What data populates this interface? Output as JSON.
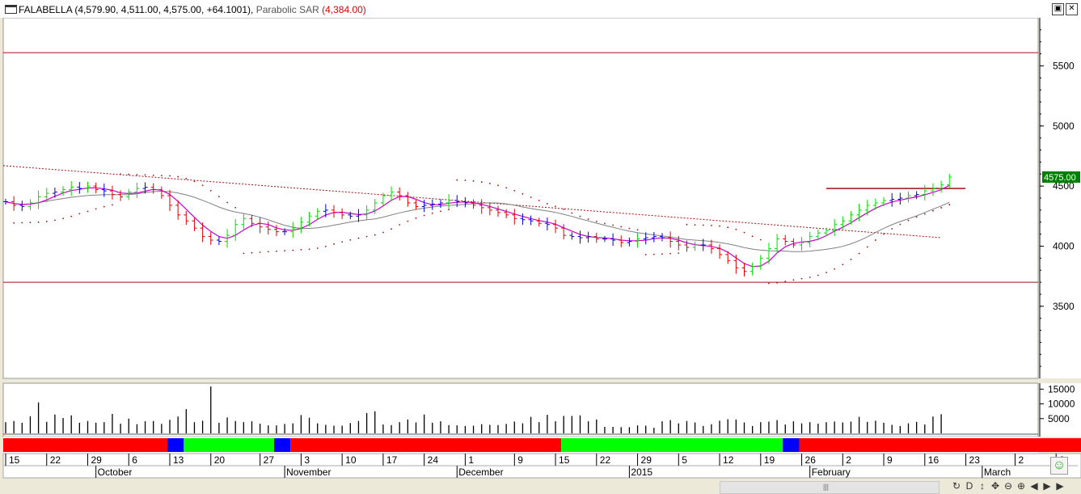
{
  "window": {
    "symbol": "FALABELLA",
    "ohlc_text": "(4,579.90, 4,511.00, 4,575.00, +64.1001),",
    "indicator_name": "Parabolic SAR",
    "indicator_value": "(4,384.00)",
    "restore_icon": "restore-icon",
    "close_icon": "close-icon",
    "restore_glyph": "▣",
    "close_glyph": "✕"
  },
  "colors": {
    "up": "#00dd00",
    "down": "#e00000",
    "neutral": "#0000cc",
    "short_ma": "#cc00cc",
    "long_ma": "#808080",
    "trendline": "#a01010",
    "sar": "#a01010",
    "volume": "#000000",
    "price_tag_bg": "#008000",
    "price_tag_fg": "#ffffff"
  },
  "chart_data": [
    {
      "type": "line",
      "chart": "price",
      "description_items": [
        "OHLC bars (green up, red down, blue neutral)",
        "Parabolic SAR dots",
        "short moving average",
        "long moving average"
      ],
      "ylim": [
        2900,
        5900
      ],
      "y_ticks": [
        3500,
        4000,
        4500,
        5000,
        5500
      ],
      "last_price_tag": "4575.00",
      "horizontal_levels": [
        5610,
        3700
      ],
      "resistance_segment": {
        "from_bar": 100,
        "to_bar": 114,
        "value": 4480
      },
      "trendline": {
        "from_bar": 0,
        "from_value": 4670,
        "to_bar": 114,
        "to_value": 4070
      },
      "bars": [
        [
          4,
          3
        ],
        [
          4,
          2
        ],
        [
          4,
          2
        ],
        [
          4,
          2
        ],
        [
          4,
          2
        ],
        [
          4,
          1
        ],
        [
          4,
          1
        ],
        [
          4,
          1
        ],
        [
          4,
          1
        ],
        [
          4,
          1
        ],
        [
          4,
          1
        ],
        [
          4,
          1
        ],
        [
          4,
          0
        ],
        [
          4,
          0
        ],
        [
          4,
          0
        ],
        [
          4,
          0
        ],
        [
          5,
          0
        ],
        [
          5,
          0
        ],
        [
          5,
          0
        ],
        [
          5,
          0
        ],
        [
          5,
          0
        ],
        [
          5,
          0
        ],
        [
          5,
          0
        ],
        [
          5,
          0
        ],
        [
          5,
          0
        ],
        [
          5,
          0
        ],
        [
          5,
          0
        ],
        [
          5,
          0
        ],
        [
          5,
          0
        ],
        [
          5,
          0
        ],
        [
          5,
          0
        ],
        [
          6,
          0
        ],
        [
          6,
          0
        ],
        [
          6,
          0
        ],
        [
          6,
          0
        ],
        [
          6,
          0
        ],
        [
          6,
          0
        ],
        [
          6,
          0
        ],
        [
          6,
          0
        ],
        [
          6,
          0
        ],
        [
          6,
          0
        ],
        [
          6,
          0
        ],
        [
          6,
          0
        ],
        [
          6,
          0
        ],
        [
          6,
          0
        ],
        [
          6,
          0
        ],
        [
          7,
          0
        ],
        [
          7,
          0
        ],
        [
          7,
          0
        ],
        [
          7,
          0
        ],
        [
          7,
          0
        ],
        [
          7,
          0
        ],
        [
          7,
          0
        ],
        [
          7,
          0
        ],
        [
          7,
          0
        ],
        [
          7,
          0
        ],
        [
          7,
          0
        ],
        [
          7,
          0
        ],
        [
          7,
          0
        ],
        [
          7,
          0
        ],
        [
          7,
          0
        ],
        [
          8,
          0
        ],
        [
          8,
          0
        ],
        [
          8,
          0
        ],
        [
          8,
          0
        ],
        [
          8,
          0
        ],
        [
          8,
          0
        ],
        [
          8,
          0
        ],
        [
          8,
          0
        ],
        [
          8,
          0
        ],
        [
          8,
          0
        ],
        [
          8,
          0
        ],
        [
          8,
          0
        ],
        [
          8,
          0
        ],
        [
          8,
          0
        ],
        [
          8,
          0
        ],
        [
          9,
          0
        ],
        [
          9,
          0
        ],
        [
          9,
          0
        ],
        [
          9,
          0
        ],
        [
          9,
          0
        ],
        [
          9,
          0
        ],
        [
          9,
          0
        ],
        [
          9,
          0
        ],
        [
          9,
          0
        ],
        [
          9,
          0
        ],
        [
          9,
          0
        ],
        [
          9,
          0
        ],
        [
          9,
          0
        ],
        [
          9,
          0
        ],
        [
          9,
          0
        ],
        [
          10,
          0
        ],
        [
          10,
          0
        ],
        [
          10,
          0
        ],
        [
          10,
          0
        ],
        [
          10,
          0
        ],
        [
          10,
          0
        ],
        [
          10,
          0
        ],
        [
          10,
          0
        ],
        [
          10,
          0
        ],
        [
          10,
          0
        ],
        [
          10,
          0
        ],
        [
          10,
          0
        ],
        [
          10,
          0
        ],
        [
          10,
          0
        ],
        [
          10,
          0
        ],
        [
          10,
          0
        ],
        [
          10,
          0
        ],
        [
          10,
          0
        ],
        [
          10,
          0
        ],
        [
          10,
          0
        ],
        [
          10,
          0
        ]
      ],
      "closes": [
        4370,
        4340,
        4330,
        4360,
        4410,
        4440,
        4450,
        4470,
        4490,
        4480,
        4500,
        4470,
        4460,
        4430,
        4410,
        4450,
        4480,
        4490,
        4470,
        4420,
        4340,
        4260,
        4210,
        4150,
        4080,
        4050,
        4040,
        4090,
        4180,
        4230,
        4190,
        4160,
        4140,
        4120,
        4120,
        4150,
        4200,
        4250,
        4290,
        4300,
        4280,
        4260,
        4250,
        4260,
        4300,
        4360,
        4420,
        4450,
        4420,
        4360,
        4330,
        4340,
        4350,
        4360,
        4380,
        4370,
        4360,
        4340,
        4320,
        4300,
        4280,
        4260,
        4230,
        4220,
        4210,
        4190,
        4180,
        4150,
        4090,
        4080,
        4070,
        4080,
        4060,
        4060,
        4050,
        4030,
        4040,
        4060,
        4070,
        4080,
        4070,
        4040,
        4010,
        3990,
        4010,
        4010,
        3980,
        3930,
        3880,
        3820,
        3790,
        3830,
        3900,
        3980,
        4060,
        4040,
        4010,
        4030,
        4080,
        4110,
        4130,
        4180,
        4210,
        4260,
        4300,
        4340,
        4360,
        4380,
        4390,
        4400,
        4420,
        4430,
        4460,
        4480,
        4510,
        4575
      ],
      "sar_values": "derived",
      "series": [
        {
          "name": "Parabolic SAR"
        }
      ]
    },
    {
      "type": "bar",
      "chart": "volume",
      "ylim": [
        0,
        17000
      ],
      "y_ticks": [
        5000,
        10000,
        15000
      ],
      "tick_labels": [
        "5000",
        "10000",
        "15000"
      ],
      "values": [
        3800,
        4200,
        3600,
        5800,
        10500,
        3900,
        6400,
        5200,
        6100,
        3600,
        4200,
        3600,
        3800,
        6600,
        3300,
        5000,
        3100,
        4100,
        4200,
        3200,
        4600,
        5700,
        8200,
        3800,
        4300,
        15900,
        3600,
        5400,
        4200,
        3800,
        4100,
        3300,
        2700,
        2700,
        3200,
        3400,
        6200,
        5300,
        3400,
        2900,
        2600,
        2600,
        3500,
        4200,
        6900,
        7500,
        3000,
        2800,
        3800,
        4700,
        3700,
        6400,
        3600,
        4100,
        2800,
        2700,
        2500,
        2600,
        3100,
        2900,
        2800,
        3200,
        4000,
        3400,
        5600,
        3800,
        6300,
        4100,
        5900,
        5900,
        6100,
        4100,
        4700,
        2200,
        2200,
        2100,
        2100,
        2700,
        2600,
        1900,
        4100,
        4500,
        3400,
        4200,
        3700,
        2500,
        3100,
        4300,
        4800,
        4700,
        3700,
        2500,
        3800,
        4000,
        4500,
        3000,
        4100,
        3400,
        3800,
        3300,
        3800,
        4000,
        3700,
        4000,
        5600,
        3900,
        4300,
        3600,
        2900,
        2500,
        3400,
        3900,
        3000,
        5700,
        6500
      ]
    }
  ],
  "xaxis": {
    "day_ticks": [
      "15",
      "22",
      "29",
      "6",
      "13",
      "20",
      "27",
      "3",
      "10",
      "17",
      "24",
      "1",
      "9",
      "15",
      "22",
      "29",
      "5",
      "12",
      "19",
      "26",
      "2",
      "9",
      "16",
      "23",
      "2",
      "9"
    ],
    "month_labels": [
      "October",
      "November",
      "December",
      "2015",
      "February",
      "March"
    ]
  },
  "signal_band": [
    {
      "color": "#ff0000",
      "bars": 20
    },
    {
      "color": "#0000ff",
      "bars": 2
    },
    {
      "color": "#00ff00",
      "bars": 11
    },
    {
      "color": "#0000ff",
      "bars": 2
    },
    {
      "color": "#ff0000",
      "bars": 33
    },
    {
      "color": "#00ff00",
      "bars": 27
    },
    {
      "color": "#0000ff",
      "bars": 2
    },
    {
      "color": "#ff0000",
      "bars": 74
    },
    {
      "color": "#0000ff",
      "bars": 2
    },
    {
      "color": "#00ff00",
      "bars": 26
    }
  ],
  "scrollbar": {
    "grip": "|||"
  },
  "nav": {
    "icons": [
      "refresh-icon",
      "d-icon",
      "pan-icon",
      "move-icon",
      "zoom-out-icon",
      "zoom-in-icon",
      "first-icon",
      "play-icon",
      "last-icon"
    ],
    "glyphs": [
      "↻",
      "D",
      "↕",
      "✥",
      "⊖",
      "⊕",
      "◀",
      "▶",
      "▶"
    ]
  },
  "smiley_glyph": "☺"
}
